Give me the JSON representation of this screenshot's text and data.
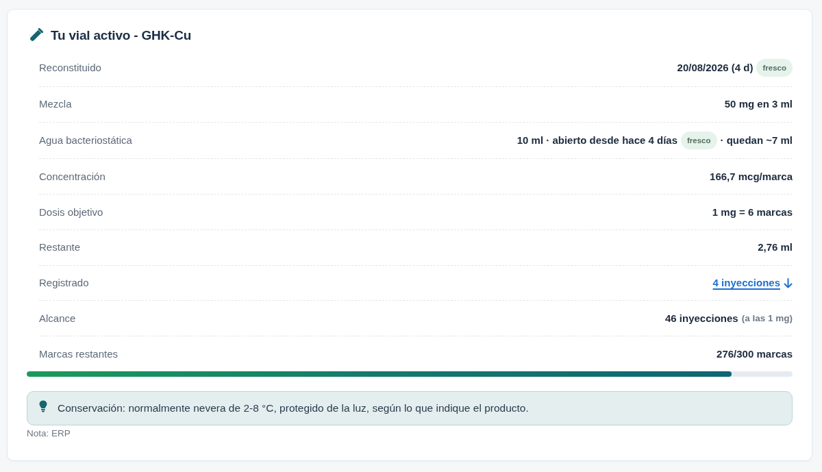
{
  "card": {
    "title": "Tu vial activo - GHK-Cu",
    "rows": [
      {
        "label": "Reconstituido",
        "value": [
          {
            "kind": "strong",
            "text": "20/08/2026 (4 d)"
          },
          {
            "kind": "badge",
            "text": "fresco"
          }
        ]
      },
      {
        "label": "Mezcla",
        "value": [
          {
            "kind": "strong",
            "text": "50 mg en 3 ml"
          }
        ]
      },
      {
        "label": "Agua bacteriostática",
        "value": [
          {
            "kind": "strong",
            "text": "10 ml · abierto desde hace 4 días"
          },
          {
            "kind": "badge",
            "text": "fresco"
          },
          {
            "kind": "strong",
            "text": "· quedan ~7 ml"
          }
        ]
      },
      {
        "label": "Concentración",
        "value": [
          {
            "kind": "strong",
            "text": "166,7 mcg/marca"
          }
        ]
      },
      {
        "label": "Dosis objetivo",
        "value": [
          {
            "kind": "strong",
            "text": "1 mg = 6 marcas"
          }
        ]
      },
      {
        "label": "Restante",
        "value": [
          {
            "kind": "strong",
            "text": "2,76 ml"
          }
        ]
      },
      {
        "label": "Registrado",
        "value": [
          {
            "kind": "link",
            "text": "4 inyecciones"
          }
        ]
      },
      {
        "label": "Alcance",
        "value": [
          {
            "kind": "strong",
            "text": "46 inyecciones"
          },
          {
            "kind": "muted",
            "text": "(a las 1 mg)"
          }
        ]
      },
      {
        "label": "Marcas restantes",
        "value": [
          {
            "kind": "strong",
            "text": "276/300 marcas"
          }
        ]
      }
    ],
    "progress": {
      "level": 0.92
    },
    "info": {
      "text": "Conservación: normalmente nevera de 2-8 °C, protegido de la luz, según lo que indique el producto."
    },
    "note": "Nota: ERP"
  }
}
